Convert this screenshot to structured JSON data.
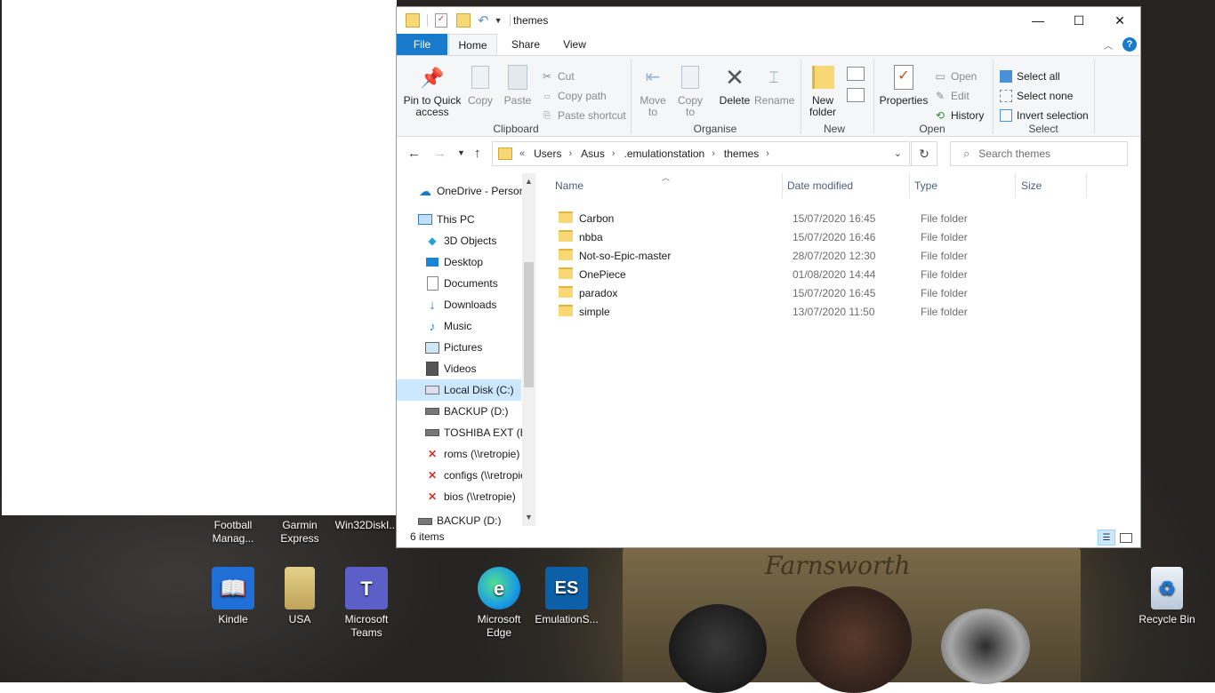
{
  "window": {
    "title": "themes",
    "controls": {
      "minimize": "—",
      "maximize": "☐",
      "close": "✕"
    }
  },
  "ribbon": {
    "tabs": [
      {
        "label": "File"
      },
      {
        "label": "Home"
      },
      {
        "label": "Share"
      },
      {
        "label": "View"
      }
    ],
    "groups": {
      "clipboard": {
        "label": "Clipboard",
        "pin": "Pin to Quick access",
        "copy": "Copy",
        "paste": "Paste",
        "cut": "Cut",
        "copy_path": "Copy path",
        "paste_shortcut": "Paste shortcut"
      },
      "organise": {
        "label": "Organise",
        "move_to": "Move to",
        "copy_to": "Copy to",
        "delete": "Delete",
        "rename": "Rename"
      },
      "new": {
        "label": "New",
        "new_folder": "New folder"
      },
      "open": {
        "label": "Open",
        "properties": "Properties",
        "open": "Open",
        "edit": "Edit",
        "history": "History"
      },
      "select": {
        "label": "Select",
        "select_all": "Select all",
        "select_none": "Select none",
        "invert": "Invert selection"
      }
    }
  },
  "address": {
    "prefix": "«",
    "crumbs": [
      "Users",
      "Asus",
      ".emulationstation",
      "themes"
    ],
    "search_placeholder": "Search themes"
  },
  "nav": {
    "items": [
      {
        "label": "OneDrive - Personal",
        "icon": "cloud-icon"
      },
      {
        "label": "This PC",
        "icon": "computer-icon"
      },
      {
        "label": "3D Objects",
        "icon": "cube-icon"
      },
      {
        "label": "Desktop",
        "icon": "desktop-icon"
      },
      {
        "label": "Documents",
        "icon": "document-icon"
      },
      {
        "label": "Downloads",
        "icon": "download-icon"
      },
      {
        "label": "Music",
        "icon": "music-icon"
      },
      {
        "label": "Pictures",
        "icon": "picture-icon"
      },
      {
        "label": "Videos",
        "icon": "video-icon"
      },
      {
        "label": "Local Disk (C:)",
        "icon": "drive-icon"
      },
      {
        "label": "BACKUP (D:)",
        "icon": "drive-icon"
      },
      {
        "label": "TOSHIBA EXT (E:)",
        "icon": "drive-icon"
      },
      {
        "label": "roms (\\\\retropie)",
        "icon": "network-drive-icon"
      },
      {
        "label": "configs (\\\\retropie)",
        "icon": "network-drive-icon"
      },
      {
        "label": "bios (\\\\retropie)",
        "icon": "network-drive-icon"
      },
      {
        "label": "BACKUP (D:)",
        "icon": "drive-icon"
      }
    ]
  },
  "files": {
    "columns": [
      "Name",
      "Date modified",
      "Type",
      "Size"
    ],
    "rows": [
      {
        "name": "Carbon",
        "date": "15/07/2020 16:45",
        "type": "File folder",
        "size": ""
      },
      {
        "name": "nbba",
        "date": "15/07/2020 16:46",
        "type": "File folder",
        "size": ""
      },
      {
        "name": "Not-so-Epic-master",
        "date": "28/07/2020 12:30",
        "type": "File folder",
        "size": ""
      },
      {
        "name": "OnePiece",
        "date": "01/08/2020 14:44",
        "type": "File folder",
        "size": ""
      },
      {
        "name": "paradox",
        "date": "15/07/2020 16:45",
        "type": "File folder",
        "size": ""
      },
      {
        "name": "simple",
        "date": "13/07/2020 11:50",
        "type": "File folder",
        "size": ""
      }
    ]
  },
  "status": {
    "count": "6 items"
  },
  "desktop": {
    "top_labels": [
      "Football Manag...",
      "Garmin Express",
      "Win32DiskI..."
    ],
    "icons": [
      {
        "label": "Kindle",
        "glyph": "📖",
        "color": "#1f6fd6"
      },
      {
        "label": "USA",
        "glyph": "",
        "color": "#d8c27a"
      },
      {
        "label": "Microsoft Teams",
        "glyph": "T",
        "color": "#5b5fc7"
      },
      {
        "label": "Microsoft Edge",
        "glyph": "e",
        "color": "#1b9de2"
      },
      {
        "label": "EmulationS...",
        "glyph": "ES",
        "color": "#0d5fa8"
      },
      {
        "label": "Recycle Bin",
        "glyph": "♻",
        "color": "#c9d6e6"
      }
    ],
    "pedal_text": "Farnsworth"
  }
}
